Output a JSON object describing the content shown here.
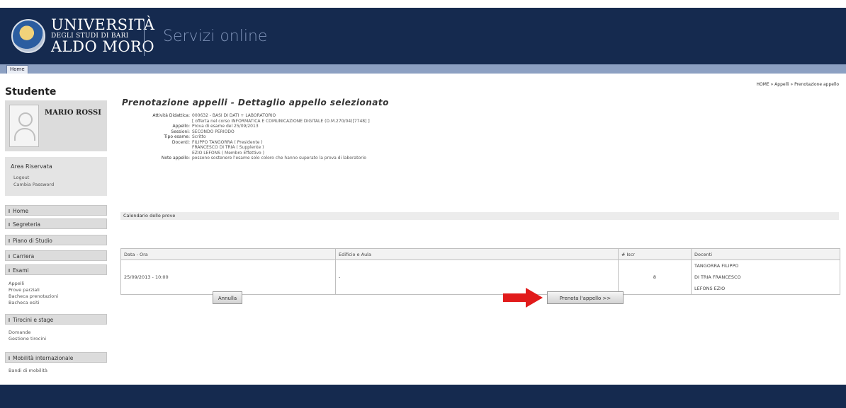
{
  "header": {
    "logo_line1": "UNIVERSITÀ",
    "logo_line2": "DEGLI STUDI DI BARI",
    "logo_line3": "ALDO MORO",
    "service_title": "Servizi online"
  },
  "nav": {
    "home_tab": "Home"
  },
  "sidebar": {
    "title": "Studente",
    "student_name": "MARIO ROSSI",
    "area_title": "Area Riservata",
    "area_links": [
      "Logout",
      "Cambia Password"
    ],
    "menu": [
      {
        "label": "Home"
      },
      {
        "label": "Segreteria"
      },
      {
        "label": "Piano di Studio"
      },
      {
        "label": "Carriera"
      },
      {
        "label": "Esami"
      }
    ],
    "esami_subitems": [
      "Appelli",
      "Prove parziali",
      "Bacheca prenotazioni",
      "Bacheca esiti"
    ],
    "tirocini_label": "Tirocini e stage",
    "tirocini_subitems": [
      "Domande",
      "Gestione tirocini"
    ],
    "mobilita_label": "Mobilità internazionale",
    "mobilita_subitems": [
      "Bandi di mobilità"
    ]
  },
  "main": {
    "breadcrumb": "HOME » Appelli » Prenotazione appello",
    "page_title": "Prenotazione appelli - Dettaglio appello selezionato",
    "details": [
      {
        "label": "Attività Didattica:",
        "value": "000632 - BASI DI DATI + LABORATORIO"
      },
      {
        "label": "",
        "value": "[ offerta nel corso INFORMATICA E COMUNICAZIONE DIGITALE (D.M.270/04)[7748] ]"
      },
      {
        "label": "Appello:",
        "value": "Prova di esame del 25/09/2013"
      },
      {
        "label": "Sessioni:",
        "value": "SECONDO PERIODO"
      },
      {
        "label": "Tipo esame:",
        "value": "Scritto"
      },
      {
        "label": "Docenti:",
        "value": "FILIPPO TANGORRA ( Presidente )"
      },
      {
        "label": "",
        "value": "FRANCESCO DI TRIA ( Supplente )"
      },
      {
        "label": "",
        "value": "EZIO LEFONS ( Membro Effettivo )"
      },
      {
        "label": "Note appello:",
        "value": "possono sostenere l'esame solo coloro che hanno superato la prova di laboratorio"
      }
    ],
    "calendar_title": "Calendario delle prove",
    "table": {
      "headers": [
        "Data - Ora",
        "Edificio e Aula",
        "# Iscr",
        "Docenti"
      ],
      "row": {
        "data_ora": "25/09/2013 - 10:00",
        "aula": "-",
        "iscritti": "8",
        "docenti": [
          "TANGORRA FILIPPO",
          "DI TRIA FRANCESCO",
          "LEFONS EZIO"
        ]
      }
    },
    "annulla_label": "Annulla",
    "prenota_label": "Prenota l'appello >>"
  },
  "colors": {
    "header_bg": "#152a4f",
    "nav_bg": "#8ca0c2",
    "arrow": "#e11b1b"
  }
}
